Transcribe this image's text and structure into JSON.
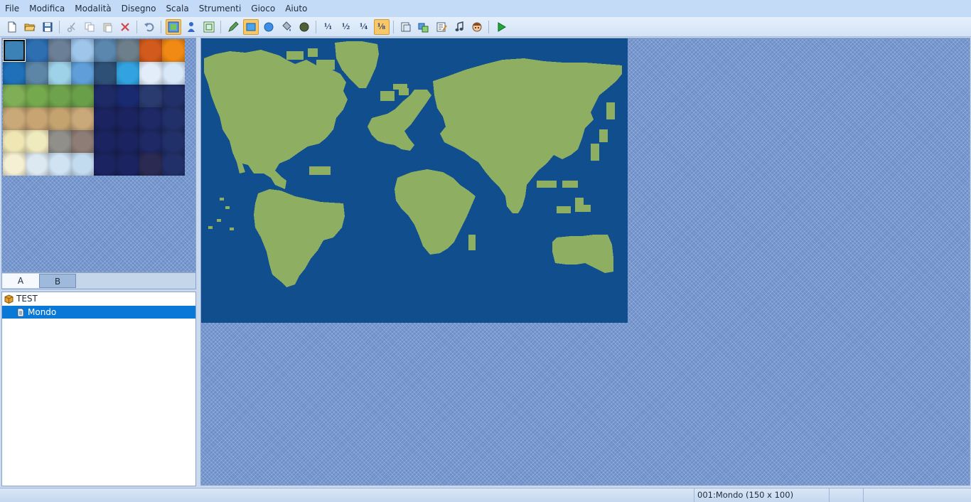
{
  "menu": [
    "File",
    "Modifica",
    "Modalità",
    "Disegno",
    "Scala",
    "Strumenti",
    "Gioco",
    "Aiuto"
  ],
  "toolbar": {
    "buttons": [
      {
        "name": "new-project-button",
        "icon": "new-document-icon"
      },
      {
        "name": "open-project-button",
        "icon": "open-folder-icon"
      },
      {
        "name": "save-project-button",
        "icon": "floppy-disk-icon"
      },
      {
        "sep": true
      },
      {
        "name": "cut-button",
        "icon": "scissors-icon"
      },
      {
        "name": "copy-button",
        "icon": "copy-icon"
      },
      {
        "name": "paste-button",
        "icon": "paste-icon"
      },
      {
        "name": "delete-button",
        "icon": "delete-x-icon"
      },
      {
        "sep": true
      },
      {
        "name": "undo-button",
        "icon": "undo-icon"
      },
      {
        "sep": true
      },
      {
        "name": "map-mode-button",
        "icon": "map-layer-icon",
        "active": true
      },
      {
        "name": "event-mode-button",
        "icon": "event-person-icon"
      },
      {
        "name": "region-mode-button",
        "icon": "region-icon"
      },
      {
        "sep": true
      },
      {
        "name": "pencil-tool-button",
        "icon": "pencil-icon"
      },
      {
        "name": "rectangle-tool-button",
        "icon": "rectangle-icon",
        "active": true
      },
      {
        "name": "ellipse-tool-button",
        "icon": "ellipse-icon"
      },
      {
        "name": "fill-tool-button",
        "icon": "paint-bucket-icon"
      },
      {
        "name": "shadow-pen-button",
        "icon": "shadow-pen-icon"
      },
      {
        "sep": true
      },
      {
        "name": "zoom-1-1-button",
        "icon": "zoom-1-1-icon",
        "label": "¹⁄₁"
      },
      {
        "name": "zoom-1-2-button",
        "icon": "zoom-1-2-icon",
        "label": "¹⁄₂"
      },
      {
        "name": "zoom-1-4-button",
        "icon": "zoom-1-4-icon",
        "label": "¹⁄₄"
      },
      {
        "name": "zoom-1-8-button",
        "icon": "zoom-1-8-icon",
        "label": "¹⁄₈",
        "active": true
      },
      {
        "sep": true
      },
      {
        "name": "database-button",
        "icon": "database-icon"
      },
      {
        "name": "resource-manager-button",
        "icon": "resource-manager-icon"
      },
      {
        "name": "script-editor-button",
        "icon": "script-editor-icon"
      },
      {
        "name": "sound-test-button",
        "icon": "music-note-icon"
      },
      {
        "name": "character-generator-button",
        "icon": "character-face-icon"
      },
      {
        "sep": true
      },
      {
        "name": "playtest-button",
        "icon": "play-triangle-icon"
      }
    ]
  },
  "tileset": {
    "selected_index": 0,
    "tiles": [
      "#3d82b7",
      "#2e6fb2",
      "#6b7f97",
      "#9fc6ea",
      "#5b86ad",
      "#6d7f8a",
      "#d25a1c",
      "#f08a14",
      "#1f70b8",
      "#5c85a6",
      "#9ed2e8",
      "#5f9ed8",
      "#2e5076",
      "#32a3e0",
      "#e2edf9",
      "#d8e8f8",
      "#7fae56",
      "#74a94e",
      "#6fa24c",
      "#6a9f4a",
      "#1d2a66",
      "#1a2a70",
      "#2a3b6f",
      "#22306a",
      "#c9a978",
      "#c8a473",
      "#c4a36f",
      "#c9a87a",
      "#1b2460",
      "#1b2460",
      "#1e2966",
      "#22306a",
      "#efe6b4",
      "#f0eabf",
      "#918f8a",
      "#8e7c76",
      "#1b2460",
      "#1b2460",
      "#1e2966",
      "#22306a",
      "#f5efd3",
      "#dde9f1",
      "#cfe3f3",
      "#c3dbef",
      "#1b2460",
      "#1b2460",
      "#2b2a53",
      "#22306a"
    ],
    "tabs": [
      "A",
      "B"
    ]
  },
  "map_tree": {
    "root": "TEST",
    "maps": [
      "Mondo"
    ]
  },
  "status": {
    "left": "",
    "map_info": "001:Mondo (150 x 100)"
  },
  "colors": {
    "ocean": "#114e8e",
    "land": "#8eae62",
    "pattern": "#6d8fc9",
    "selection": "#0a78d6",
    "active_tool": "#f7c76a"
  }
}
